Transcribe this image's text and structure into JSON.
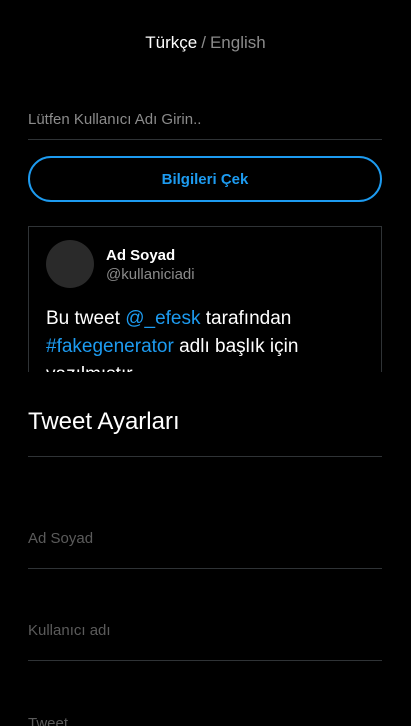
{
  "language": {
    "active": "Türkçe",
    "separator": "/",
    "inactive": "English"
  },
  "fetch": {
    "username_placeholder": "Lütfen Kullanıcı Adı Girin..",
    "button_label": "Bilgileri Çek"
  },
  "tweet": {
    "display_name": "Ad Soyad",
    "handle": "@kullaniciadi",
    "text_part1": "Bu tweet ",
    "mention": "@_efesk",
    "text_part2": " tarafından ",
    "hashtag": "#fakegenerator",
    "text_part3": " adlı başlık için yazılmıştır."
  },
  "settings": {
    "title": "Tweet Ayarları",
    "name_placeholder": "Ad Soyad",
    "username_placeholder": "Kullanıcı adı",
    "third_placeholder": "Tweet"
  },
  "colors": {
    "background": "#000000",
    "accent": "#1d9bf0",
    "muted_text": "#8b8b8b",
    "divider": "#2f3336"
  }
}
